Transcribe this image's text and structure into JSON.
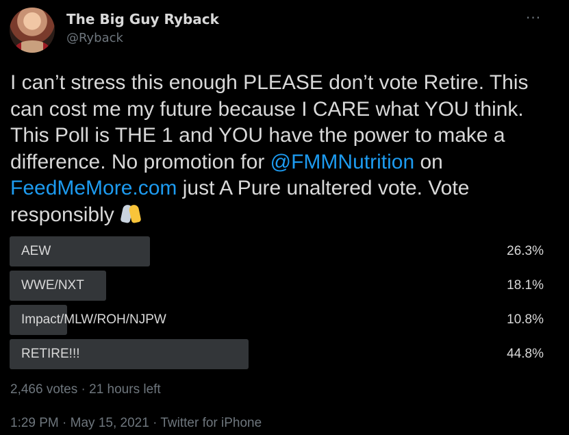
{
  "author": {
    "name": "The Big Guy Ryback",
    "handle": "@Ryback",
    "more_icon": "more-dots-icon"
  },
  "tweet": {
    "text_parts": [
      "I can’t stress this enough PLEASE don’t vote Retire. This\ncan cost me my future because I CARE what YOU think.\nThis Poll is THE 1 and YOU have the power to make a\ndifference. No promotion for ",
      "@FMMNutrition",
      " on\n",
      "FeedMeMore.com",
      " just A Pure unaltered vote. Vote\nresponsibly"
    ],
    "emoji": "folded-hands-emoji"
  },
  "poll": {
    "options": [
      {
        "label": "AEW",
        "percent": "26.3%",
        "share": 0.263
      },
      {
        "label": "WWE/NXT",
        "percent": "18.1%",
        "share": 0.181
      },
      {
        "label": "Impact/MLW/ROH/NJPW",
        "percent": "10.8%",
        "share": 0.108
      },
      {
        "label": "RETIRE!!!",
        "percent": "44.8%",
        "share": 0.448
      }
    ],
    "votes": "2,466 votes",
    "time_left": "21 hours left"
  },
  "meta": {
    "time": "1:29 PM",
    "date": "May 15, 2021",
    "source": "Twitter for iPhone"
  },
  "colors": {
    "background": "#000000",
    "text": "#d9d9d9",
    "muted": "#6e767d",
    "link": "#1d9bf0",
    "poll_bar": "#333639"
  }
}
